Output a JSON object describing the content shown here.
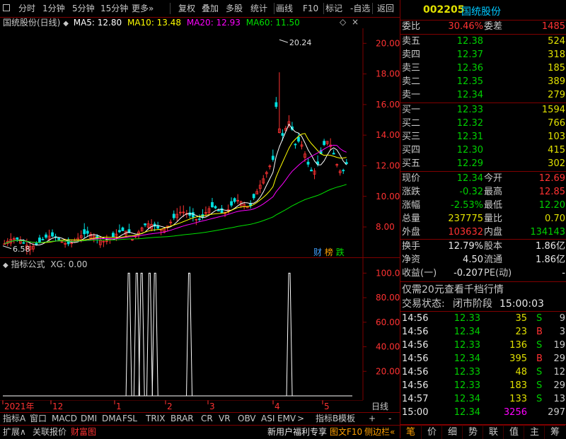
{
  "toolbar": {
    "items": [
      "分时",
      "1分钟",
      "5分钟",
      "15分钟",
      "更多",
      "复权",
      "叠加",
      "多股",
      "统计",
      "画线",
      "F10",
      "标记",
      "-自选",
      "返回"
    ]
  },
  "main_chart": {
    "title": "国统股份(日线)",
    "ma5": "MA5: 12.80",
    "ma10": "MA10: 13.48",
    "ma20": "MA20: 12.93",
    "ma60": "MA60: 11.50",
    "high_label": "20.24",
    "low_label": "6.58",
    "badges": [
      "财",
      "榜",
      "跌"
    ]
  },
  "indicator": {
    "title": "指标公式",
    "xg": "XG: 0.00"
  },
  "chart_data": [
    {
      "type": "candlestick",
      "title": "国统股份(日线)",
      "y_ticks": [
        8.0,
        10.0,
        12.0,
        14.0,
        16.0,
        18.0,
        20.0
      ],
      "ylim": [
        6.2,
        20.8
      ],
      "annotations": {
        "high": 20.24,
        "low": 6.58
      },
      "series": [
        {
          "name": "MA5",
          "value": 12.8,
          "color": "#ffffff"
        },
        {
          "name": "MA10",
          "value": 13.48,
          "color": "#ffff00"
        },
        {
          "name": "MA20",
          "value": 12.93,
          "color": "#ff00ff"
        },
        {
          "name": "MA60",
          "value": 11.5,
          "color": "#00e000"
        }
      ],
      "x_labels": [
        "2021年",
        "12",
        "1",
        "2",
        "3",
        "4",
        "5"
      ]
    },
    {
      "type": "bar",
      "title": "指标公式",
      "y_ticks": [
        20.0,
        40.0,
        60.0,
        80.0,
        100.0
      ],
      "ylim": [
        0,
        110
      ],
      "spike_positions": [
        0.365,
        0.388,
        0.402,
        0.425,
        0.441,
        0.54,
        0.83
      ],
      "values": [
        100,
        100,
        100,
        100,
        100,
        100,
        100
      ]
    }
  ],
  "axis_labels": {
    "years": [
      "2021年",
      "12",
      "1",
      "2",
      "3",
      "4",
      "5"
    ],
    "dayline": "日线"
  },
  "tabs": {
    "row1": [
      "指标A",
      "窗口",
      "MACD",
      "DMI",
      "DMA",
      "FSL",
      "TRIX",
      "BRAR",
      "CR",
      "VR",
      "OBV",
      "ASI",
      "EMV",
      ">",
      "指标B",
      "模板",
      "+",
      "-"
    ],
    "row2": [
      "扩展∧",
      "关联报价",
      "财富图"
    ],
    "promo": "新用户福利专享",
    "f10": "图文F10",
    "side": "侧边栏«"
  },
  "quote": {
    "code": "002205",
    "name": "国统股份",
    "weibi_label": "委比",
    "weibi": "30.46%",
    "weicha_label": "委差",
    "weicha": "1485",
    "sells": [
      {
        "label": "卖五",
        "price": "12.38",
        "vol": "524"
      },
      {
        "label": "卖四",
        "price": "12.37",
        "vol": "318"
      },
      {
        "label": "卖三",
        "price": "12.36",
        "vol": "185"
      },
      {
        "label": "卖二",
        "price": "12.35",
        "vol": "389"
      },
      {
        "label": "卖一",
        "price": "12.34",
        "vol": "279"
      }
    ],
    "buys": [
      {
        "label": "买一",
        "price": "12.33",
        "vol": "1594"
      },
      {
        "label": "买二",
        "price": "12.32",
        "vol": "766"
      },
      {
        "label": "买三",
        "price": "12.31",
        "vol": "103"
      },
      {
        "label": "买四",
        "price": "12.30",
        "vol": "415"
      },
      {
        "label": "买五",
        "price": "12.29",
        "vol": "302"
      }
    ],
    "stats": [
      {
        "l1": "现价",
        "v1": "12.34",
        "l2": "今开",
        "v2": "12.69",
        "c1": "green",
        "c2": "red"
      },
      {
        "l1": "涨跌",
        "v1": "-0.32",
        "l2": "最高",
        "v2": "12.85",
        "c1": "green",
        "c2": "red"
      },
      {
        "l1": "涨幅",
        "v1": "-2.53%",
        "l2": "最低",
        "v2": "12.20",
        "c1": "green",
        "c2": "green"
      },
      {
        "l1": "总量",
        "v1": "237775",
        "l2": "量比",
        "v2": "0.70",
        "c1": "yellow",
        "c2": "yellow"
      },
      {
        "l1": "外盘",
        "v1": "103632",
        "l2": "内盘",
        "v2": "134143",
        "c1": "red",
        "c2": "green"
      }
    ],
    "stats2": [
      {
        "l1": "换手",
        "v1": "12.79%",
        "l2": "股本",
        "v2": "1.86亿"
      },
      {
        "l1": "净资",
        "v1": "4.50",
        "l2": "流通",
        "v2": "1.86亿"
      },
      {
        "l1": "收益(一)",
        "v1": "-0.207",
        "l2": "PE(动)",
        "v2": "-"
      }
    ],
    "promo": "仅需20元查看千档行情",
    "status_label": "交易状态:",
    "status": "闭市阶段",
    "status_time": "15:00:03"
  },
  "ticks": [
    {
      "t": "14:56",
      "p": "12.33",
      "v": "35",
      "bs": "S",
      "n": "9"
    },
    {
      "t": "14:56",
      "p": "12.34",
      "v": "23",
      "bs": "B",
      "n": "3"
    },
    {
      "t": "14:56",
      "p": "12.33",
      "v": "136",
      "bs": "S",
      "n": "19"
    },
    {
      "t": "14:56",
      "p": "12.34",
      "v": "395",
      "bs": "B",
      "n": "29"
    },
    {
      "t": "14:56",
      "p": "12.33",
      "v": "48",
      "bs": "S",
      "n": "12"
    },
    {
      "t": "14:56",
      "p": "12.33",
      "v": "183",
      "bs": "S",
      "n": "29"
    },
    {
      "t": "14:57",
      "p": "12.34",
      "v": "133",
      "bs": "S",
      "n": "13"
    },
    {
      "t": "15:00",
      "p": "12.34",
      "v": "3256",
      "bs": "",
      "n": "297"
    }
  ],
  "right_tabs": [
    "笔",
    "价",
    "细",
    "势",
    "联",
    "值",
    "主",
    "筹"
  ]
}
